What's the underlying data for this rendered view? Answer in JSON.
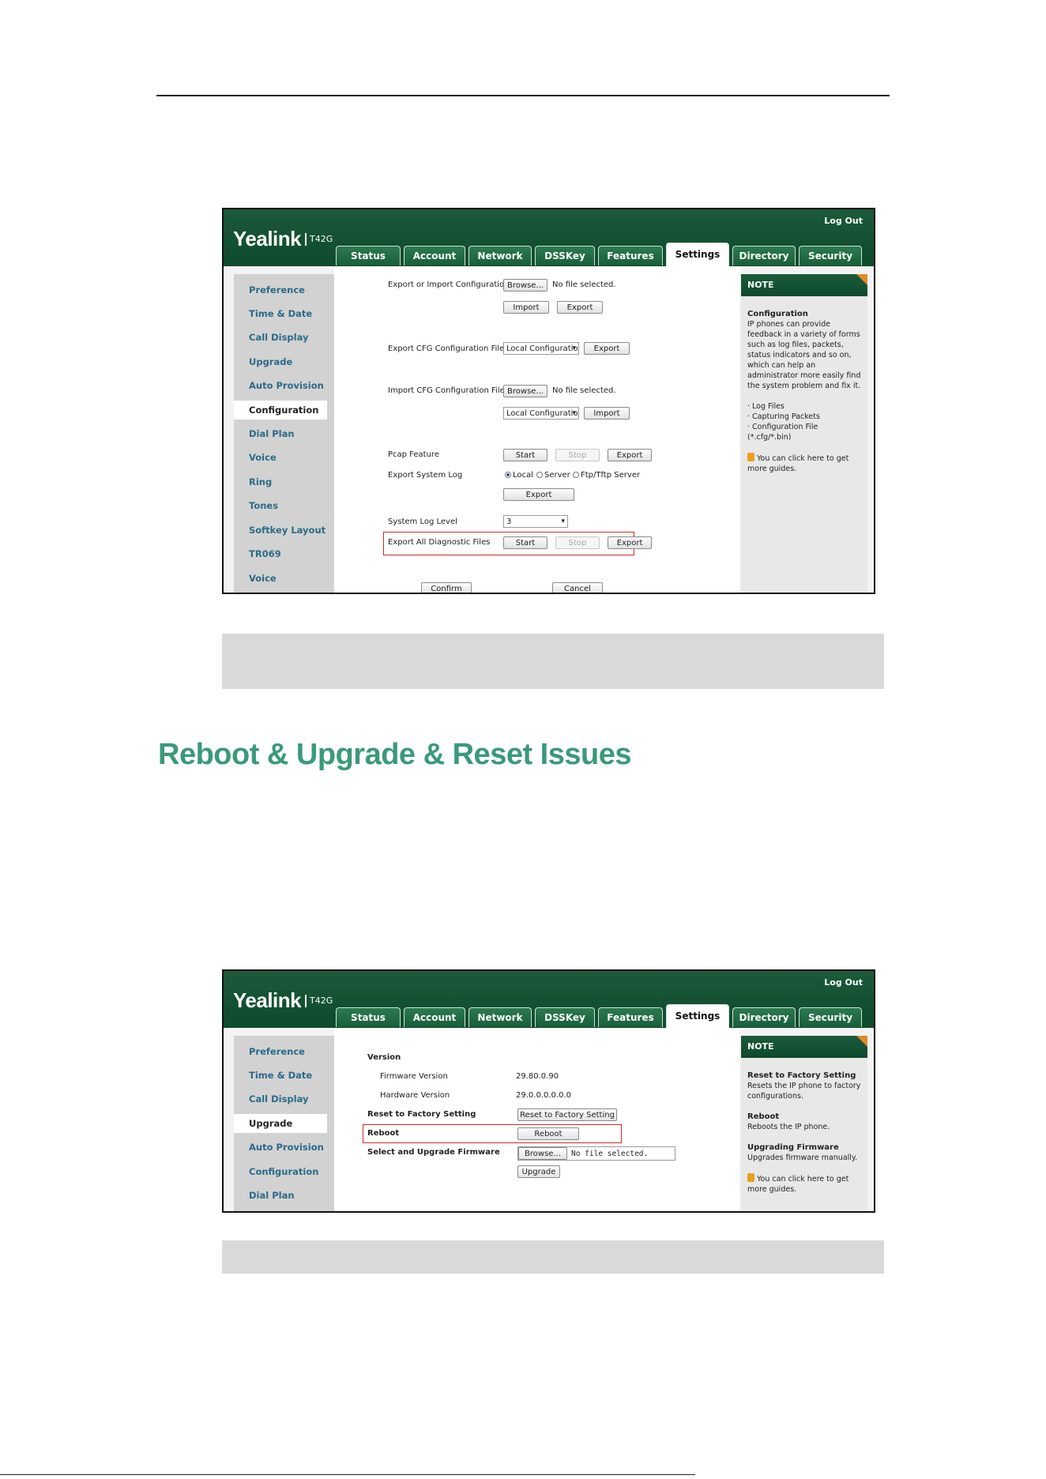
{
  "heading": "Reboot & Upgrade & Reset Issues",
  "colors": {
    "accent": "#3a9a78",
    "header_green": "#0e4a2c",
    "highlight_red": "#d62828"
  },
  "shot1": {
    "logo": "Yealink",
    "model": "T42G",
    "logout": "Log Out",
    "tabs": [
      "Status",
      "Account",
      "Network",
      "DSSKey",
      "Features",
      "Settings",
      "Directory",
      "Security"
    ],
    "active_tab": "Settings",
    "sidebar": [
      "Preference",
      "Time & Date",
      "Call Display",
      "Upgrade",
      "Auto Provision",
      "Configuration",
      "Dial Plan",
      "Voice",
      "Ring",
      "Tones",
      "Softkey Layout",
      "TR069",
      "Voice Monitoring"
    ],
    "sidebar_active": "Configuration",
    "rows": {
      "export_import_label": "Export or Import Configuration",
      "browse": "Browse...",
      "no_file": "No file selected.",
      "import": "Import",
      "export": "Export",
      "export_cfg_label": "Export CFG Configuration File",
      "local_config": "Local Configuration",
      "import_cfg_label": "Import CFG Configuration File",
      "pcap_label": "Pcap Feature",
      "start": "Start",
      "stop": "Stop",
      "export_log_label": "Export System Log",
      "radio_local": "Local",
      "radio_server": "Server",
      "radio_tftp": "Ftp/Tftp Server",
      "log_level_label": "System Log Level",
      "log_level_value": "3",
      "diag_label": "Export All Diagnostic Files",
      "confirm": "Confirm",
      "cancel": "Cancel"
    },
    "note": {
      "title": "NOTE",
      "heading": "Configuration",
      "text": "IP phones can provide feedback in a variety of forms such as log files, packets, status indicators and so on, which can help an administrator more easily find the system problem and fix it.",
      "bullets": [
        "· Log Files",
        "· Capturing Packets",
        "· Configuration File",
        "(*.cfg/*.bin)"
      ],
      "guide": "You can click here to get more guides."
    }
  },
  "shot2": {
    "logo": "Yealink",
    "model": "T42G",
    "logout": "Log Out",
    "tabs": [
      "Status",
      "Account",
      "Network",
      "DSSKey",
      "Features",
      "Settings",
      "Directory",
      "Security"
    ],
    "sidebar": [
      "Preference",
      "Time & Date",
      "Call Display",
      "Upgrade",
      "Auto Provision",
      "Configuration",
      "Dial Plan"
    ],
    "sidebar_active": "Upgrade",
    "rows": {
      "version": "Version",
      "fw_label": "Firmware Version",
      "fw_value": "29.80.0.90",
      "hw_label": "Hardware Version",
      "hw_value": "29.0.0.0.0.0.0",
      "reset_label": "Reset to Factory Setting",
      "reset_btn": "Reset to Factory Setting",
      "reboot_label": "Reboot",
      "reboot_btn": "Reboot",
      "upgrade_label": "Select and Upgrade Firmware",
      "browse": "Browse...",
      "no_file": "No file selected.",
      "upgrade_btn": "Upgrade"
    },
    "note": {
      "title": "NOTE",
      "h1": "Reset to Factory Setting",
      "t1": "Resets the IP phone to factory configurations.",
      "h2": "Reboot",
      "t2": "Reboots the IP phone.",
      "h3": "Upgrading Firmware",
      "t3": "Upgrades firmware manually.",
      "guide": "You can click here to get more guides."
    }
  }
}
